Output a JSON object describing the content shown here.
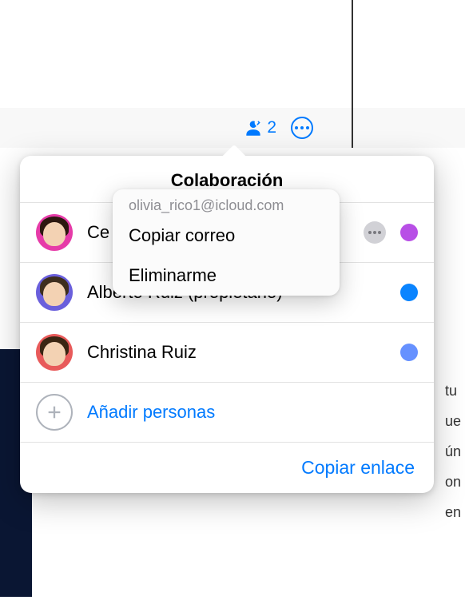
{
  "toolbar": {
    "collaborator_count": "2"
  },
  "popover": {
    "title": "Colaboración",
    "rows": [
      {
        "name": "Ce",
        "avatar_bg": "#e63ba8",
        "hair_color": "#2c1810",
        "color": "#b84fe6"
      },
      {
        "name": "Alberto Ruiz (propietario)",
        "avatar_bg": "#6a5fdc",
        "hair_color": "#3e2e1e",
        "color": "#0a84ff"
      },
      {
        "name": "Christina Ruiz",
        "avatar_bg": "#e85a5a",
        "hair_color": "#3a2512",
        "color": "#6691ff"
      }
    ],
    "add_people_label": "Añadir personas",
    "footer_link": "Copiar enlace"
  },
  "context_menu": {
    "email": "olivia_rico1@icloud.com",
    "copy_email": "Copiar correo",
    "remove_me": "Eliminarme"
  },
  "bg_fragments": [
    "tu",
    "ue",
    "ún",
    "",
    "on",
    "en"
  ]
}
